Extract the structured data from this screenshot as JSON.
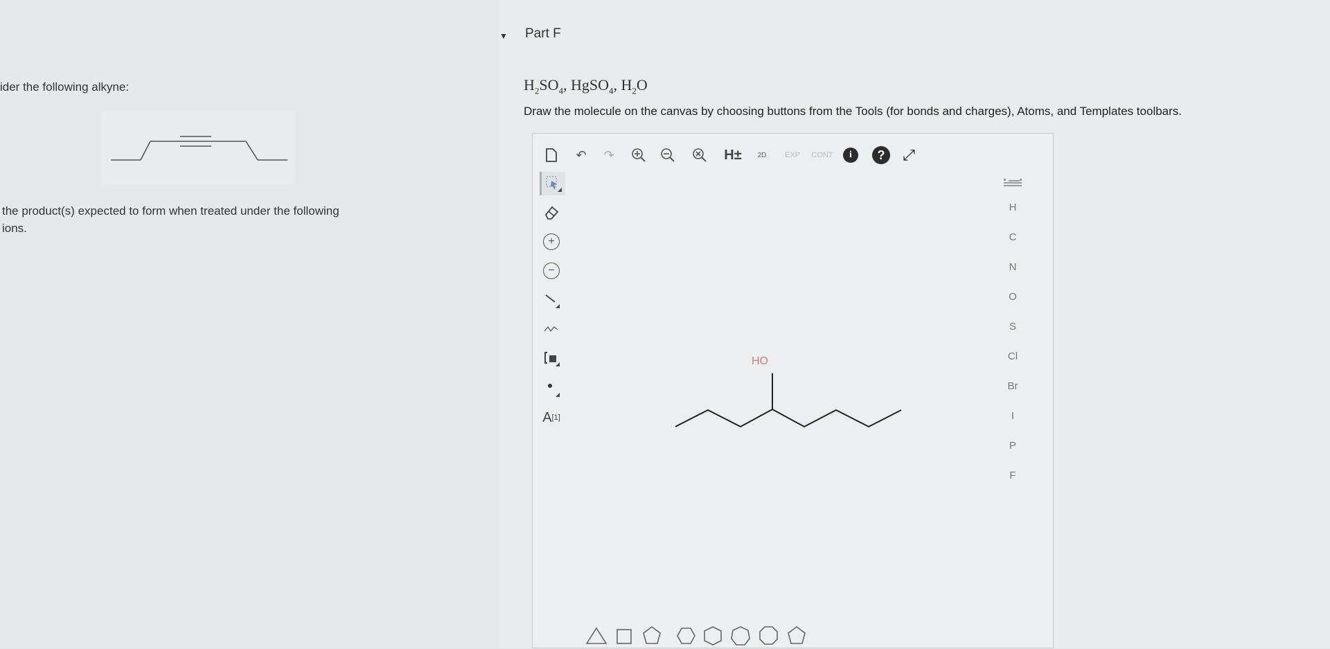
{
  "left": {
    "intro_text": "ider the following alkyne:",
    "question_line1": "the product(s) expected to form when treated under the following",
    "question_line2": "ions."
  },
  "part": {
    "toggle_icon": "caret-down-icon",
    "title": "Part F",
    "reagents": {
      "r1": "H",
      "r1_sub1": "2",
      "r1b": "SO",
      "r1_sub2": "4",
      "sep1": ", ",
      "r2": "HgSO",
      "r2_sub": "4",
      "sep2": ", ",
      "r3": "H",
      "r3_sub": "2",
      "r3b": "O"
    },
    "instructions": "Draw the molecule on the canvas by choosing buttons from the Tools (for bonds and charges), Atoms, and Templates toolbars."
  },
  "toolbar": {
    "new": "new-document-icon",
    "undo": "undo-icon",
    "redo": "redo-icon",
    "zoom_in": "zoom-in-icon",
    "zoom_out": "zoom-out-icon",
    "zoom_reset": "zoom-reset-icon",
    "h_toggle": "H±",
    "label_2d": "2D",
    "exp": "EXP",
    "cont": "CONT",
    "info": "i",
    "help": "?",
    "expand": "expand-icon"
  },
  "tools": {
    "select": "select-lasso-icon",
    "erase": "eraser-icon",
    "plus_charge": "+",
    "minus_charge": "−",
    "bond": "single-bond-icon",
    "chain": "chain-icon",
    "bracket": "bracket-icon",
    "radical": "radical-icon",
    "atom_label": "A",
    "atom_label_index": "[1]"
  },
  "atoms": [
    "H",
    "C",
    "N",
    "O",
    "S",
    "Cl",
    "Br",
    "I",
    "P",
    "F"
  ],
  "periodic_table": "periodic-table-icon",
  "canvas": {
    "oh_label": "HO"
  },
  "templates": [
    "triangle",
    "square",
    "pentagon",
    "hexagon",
    "benzene",
    "heptagon",
    "octagon",
    "cyclopentadiene"
  ]
}
